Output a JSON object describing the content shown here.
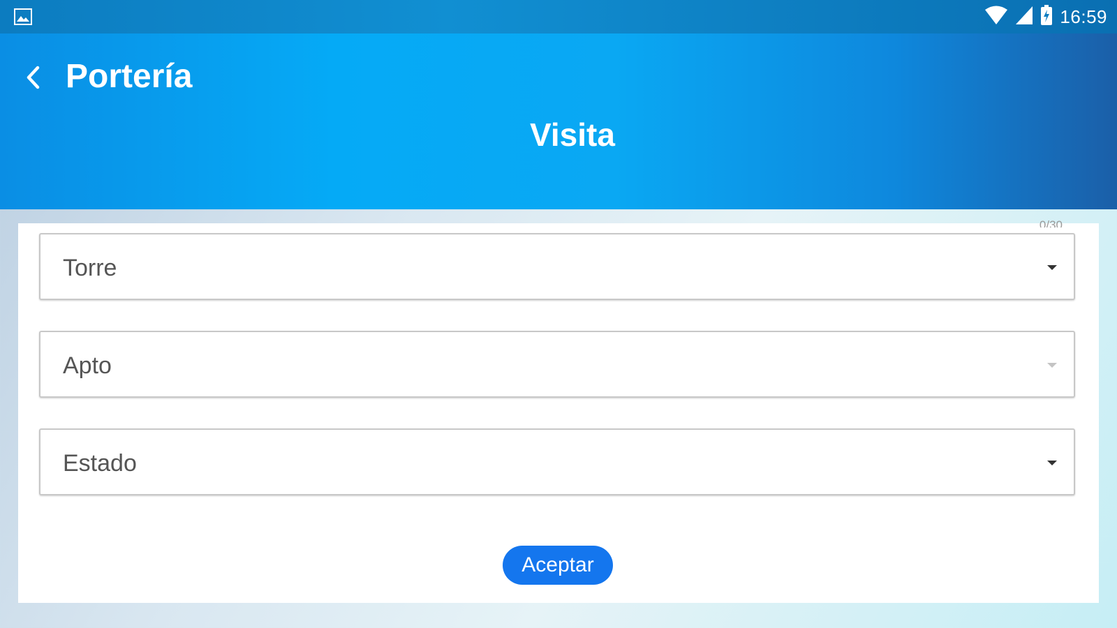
{
  "status_bar": {
    "time": "16:59",
    "icons": [
      "gallery-icon",
      "wifi-icon",
      "cell-signal-icon",
      "battery-charging-icon"
    ]
  },
  "header": {
    "app_title": "Portería",
    "screen_title": "Visita",
    "back_icon": "chevron-left-icon"
  },
  "form": {
    "counter": "0/30",
    "fields": [
      {
        "label": "Torre",
        "enabled": true
      },
      {
        "label": "Apto",
        "enabled": false
      },
      {
        "label": "Estado",
        "enabled": true
      }
    ],
    "accept_label": "Aceptar"
  },
  "colors": {
    "header_blue": "#05aaf6",
    "button_blue": "#1476ee",
    "field_border": "#c8c8c8"
  }
}
